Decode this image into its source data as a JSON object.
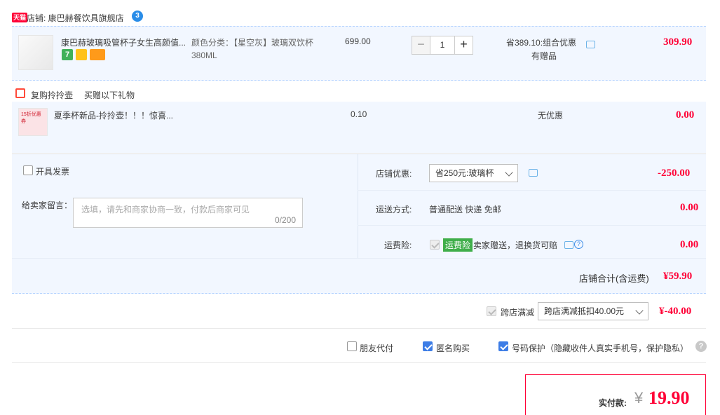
{
  "shop": {
    "tmall_tag": "天猫",
    "label": "店铺: ",
    "name": "康巴赫餐饮具旗舰店",
    "badge": "3"
  },
  "item": {
    "title": "康巴赫玻璃吸管杯子女生高颜值...",
    "sku_label": "颜色分类：【星空灰】玻璃双饮杯",
    "sku_size": "380ML",
    "unit_price": "699.00",
    "quantity": "1",
    "discount_line1": "省389.10:组合优惠",
    "discount_line2": "有赠品",
    "subtotal": "309.90",
    "badge_seven": "7"
  },
  "gift": {
    "label": "复购拎拎壶",
    "desc": "买赠以下礼物",
    "title": "夏季杯新品-拎拎壶！！！惊喜...",
    "thumb_text": "15折优惠券",
    "price": "0.10",
    "discount": "无优惠",
    "subtotal": "0.00"
  },
  "invoice": {
    "label": "开具发票"
  },
  "message": {
    "label": "给卖家留言：",
    "placeholder": "选填，请先和商家协商一致，付款后商家可见",
    "counter": "0/200"
  },
  "shop_discount": {
    "label": "店铺优惠:",
    "value": "省250元:玻璃杯",
    "amount": "-250.00"
  },
  "shipping": {
    "label": "运送方式:",
    "value": "普通配送 快递 免邮",
    "amount": "0.00"
  },
  "insurance": {
    "label": "运费险:",
    "tag": "运费险",
    "desc": "卖家赠送，退换货可赔",
    "amount": "0.00"
  },
  "shop_total": {
    "label": "店铺合计(含运费)",
    "amount": "¥59.90"
  },
  "cross_store": {
    "label": "跨店满减",
    "value": "跨店满减抵扣40.00元",
    "amount": "¥-40.00"
  },
  "options": {
    "friend_pay": "朋友代付",
    "anonymous": "匿名购买",
    "number_protect": "号码保护（隐藏收件人真实手机号，保护隐私）"
  },
  "final": {
    "label": "实付款:",
    "currency": "¥",
    "amount": "19.90"
  },
  "colors": {
    "accent": "#ff0036",
    "panel": "#f2f7ff",
    "border": "#b2d1ff"
  }
}
